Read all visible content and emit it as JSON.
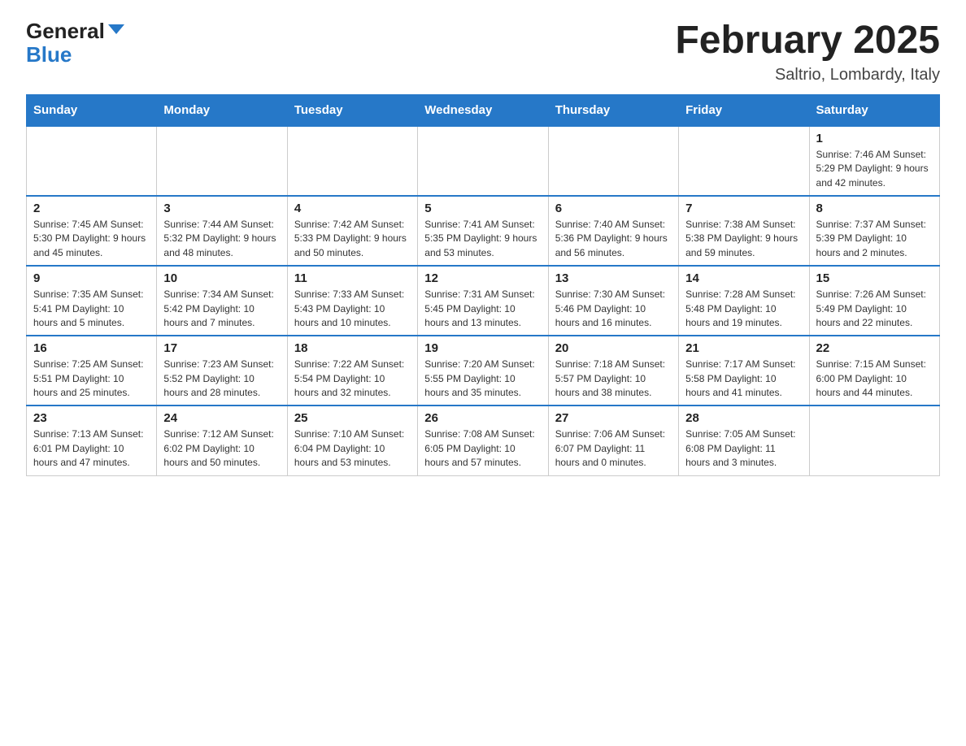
{
  "header": {
    "logo_general": "General",
    "logo_blue": "Blue",
    "month_title": "February 2025",
    "location": "Saltrio, Lombardy, Italy"
  },
  "days_of_week": [
    "Sunday",
    "Monday",
    "Tuesday",
    "Wednesday",
    "Thursday",
    "Friday",
    "Saturday"
  ],
  "weeks": [
    [
      {
        "day": "",
        "info": ""
      },
      {
        "day": "",
        "info": ""
      },
      {
        "day": "",
        "info": ""
      },
      {
        "day": "",
        "info": ""
      },
      {
        "day": "",
        "info": ""
      },
      {
        "day": "",
        "info": ""
      },
      {
        "day": "1",
        "info": "Sunrise: 7:46 AM\nSunset: 5:29 PM\nDaylight: 9 hours and 42 minutes."
      }
    ],
    [
      {
        "day": "2",
        "info": "Sunrise: 7:45 AM\nSunset: 5:30 PM\nDaylight: 9 hours and 45 minutes."
      },
      {
        "day": "3",
        "info": "Sunrise: 7:44 AM\nSunset: 5:32 PM\nDaylight: 9 hours and 48 minutes."
      },
      {
        "day": "4",
        "info": "Sunrise: 7:42 AM\nSunset: 5:33 PM\nDaylight: 9 hours and 50 minutes."
      },
      {
        "day": "5",
        "info": "Sunrise: 7:41 AM\nSunset: 5:35 PM\nDaylight: 9 hours and 53 minutes."
      },
      {
        "day": "6",
        "info": "Sunrise: 7:40 AM\nSunset: 5:36 PM\nDaylight: 9 hours and 56 minutes."
      },
      {
        "day": "7",
        "info": "Sunrise: 7:38 AM\nSunset: 5:38 PM\nDaylight: 9 hours and 59 minutes."
      },
      {
        "day": "8",
        "info": "Sunrise: 7:37 AM\nSunset: 5:39 PM\nDaylight: 10 hours and 2 minutes."
      }
    ],
    [
      {
        "day": "9",
        "info": "Sunrise: 7:35 AM\nSunset: 5:41 PM\nDaylight: 10 hours and 5 minutes."
      },
      {
        "day": "10",
        "info": "Sunrise: 7:34 AM\nSunset: 5:42 PM\nDaylight: 10 hours and 7 minutes."
      },
      {
        "day": "11",
        "info": "Sunrise: 7:33 AM\nSunset: 5:43 PM\nDaylight: 10 hours and 10 minutes."
      },
      {
        "day": "12",
        "info": "Sunrise: 7:31 AM\nSunset: 5:45 PM\nDaylight: 10 hours and 13 minutes."
      },
      {
        "day": "13",
        "info": "Sunrise: 7:30 AM\nSunset: 5:46 PM\nDaylight: 10 hours and 16 minutes."
      },
      {
        "day": "14",
        "info": "Sunrise: 7:28 AM\nSunset: 5:48 PM\nDaylight: 10 hours and 19 minutes."
      },
      {
        "day": "15",
        "info": "Sunrise: 7:26 AM\nSunset: 5:49 PM\nDaylight: 10 hours and 22 minutes."
      }
    ],
    [
      {
        "day": "16",
        "info": "Sunrise: 7:25 AM\nSunset: 5:51 PM\nDaylight: 10 hours and 25 minutes."
      },
      {
        "day": "17",
        "info": "Sunrise: 7:23 AM\nSunset: 5:52 PM\nDaylight: 10 hours and 28 minutes."
      },
      {
        "day": "18",
        "info": "Sunrise: 7:22 AM\nSunset: 5:54 PM\nDaylight: 10 hours and 32 minutes."
      },
      {
        "day": "19",
        "info": "Sunrise: 7:20 AM\nSunset: 5:55 PM\nDaylight: 10 hours and 35 minutes."
      },
      {
        "day": "20",
        "info": "Sunrise: 7:18 AM\nSunset: 5:57 PM\nDaylight: 10 hours and 38 minutes."
      },
      {
        "day": "21",
        "info": "Sunrise: 7:17 AM\nSunset: 5:58 PM\nDaylight: 10 hours and 41 minutes."
      },
      {
        "day": "22",
        "info": "Sunrise: 7:15 AM\nSunset: 6:00 PM\nDaylight: 10 hours and 44 minutes."
      }
    ],
    [
      {
        "day": "23",
        "info": "Sunrise: 7:13 AM\nSunset: 6:01 PM\nDaylight: 10 hours and 47 minutes."
      },
      {
        "day": "24",
        "info": "Sunrise: 7:12 AM\nSunset: 6:02 PM\nDaylight: 10 hours and 50 minutes."
      },
      {
        "day": "25",
        "info": "Sunrise: 7:10 AM\nSunset: 6:04 PM\nDaylight: 10 hours and 53 minutes."
      },
      {
        "day": "26",
        "info": "Sunrise: 7:08 AM\nSunset: 6:05 PM\nDaylight: 10 hours and 57 minutes."
      },
      {
        "day": "27",
        "info": "Sunrise: 7:06 AM\nSunset: 6:07 PM\nDaylight: 11 hours and 0 minutes."
      },
      {
        "day": "28",
        "info": "Sunrise: 7:05 AM\nSunset: 6:08 PM\nDaylight: 11 hours and 3 minutes."
      },
      {
        "day": "",
        "info": ""
      }
    ]
  ]
}
